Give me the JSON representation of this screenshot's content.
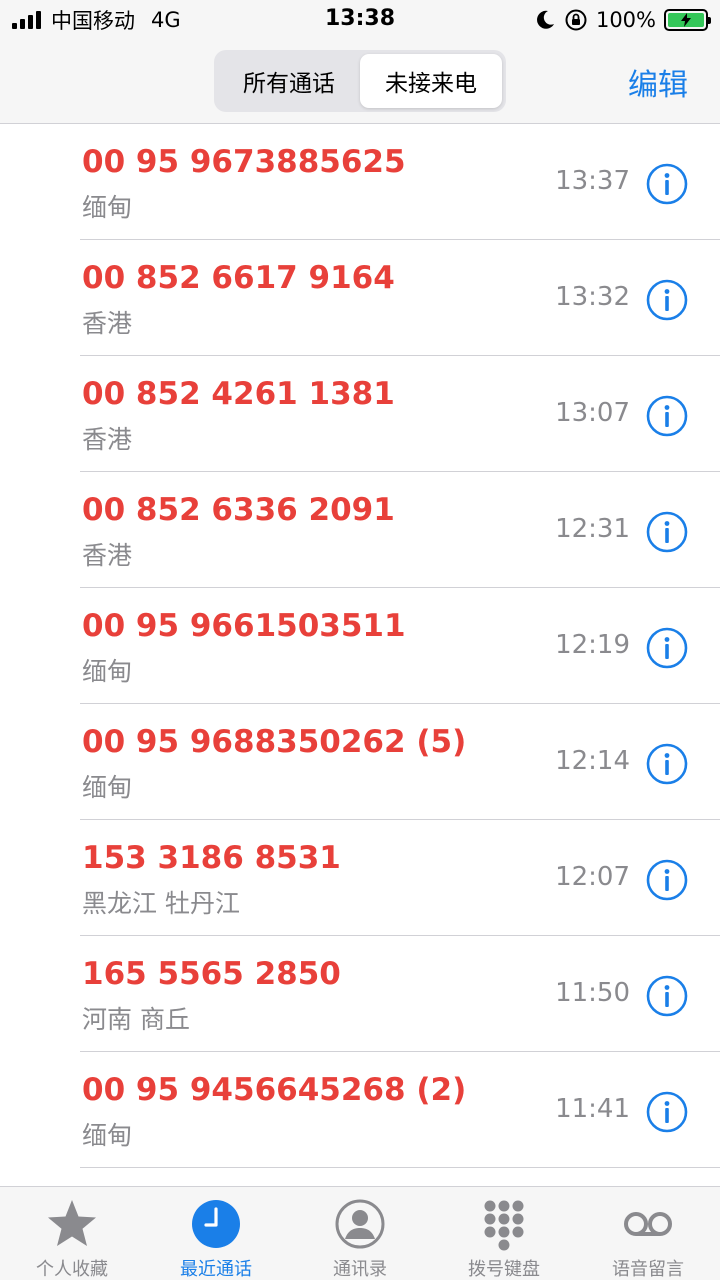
{
  "status_bar": {
    "carrier": "中国移动",
    "network": "4G",
    "time": "13:38",
    "battery": "100%",
    "battery_level": 100
  },
  "header": {
    "segments": [
      "所有通话",
      "未接来电"
    ],
    "active_segment": 1,
    "edit_label": "编辑"
  },
  "calls": [
    {
      "number": "00 95 9673885625",
      "location": "缅甸",
      "time": "13:37"
    },
    {
      "number": "00 852 6617 9164",
      "location": "香港",
      "time": "13:32"
    },
    {
      "number": "00 852 4261 1381",
      "location": "香港",
      "time": "13:07"
    },
    {
      "number": "00 852 6336 2091",
      "location": "香港",
      "time": "12:31"
    },
    {
      "number": "00 95 9661503511",
      "location": "缅甸",
      "time": "12:19"
    },
    {
      "number": "00 95 9688350262 (5)",
      "location": "缅甸",
      "time": "12:14"
    },
    {
      "number": "153 3186 8531",
      "location": "黑龙江 牡丹江",
      "time": "12:07"
    },
    {
      "number": "165 5565 2850",
      "location": "河南 商丘",
      "time": "11:50"
    },
    {
      "number": "00 95 9456645268 (2)",
      "location": "缅甸",
      "time": "11:41"
    }
  ],
  "tabs": [
    {
      "label": "个人收藏",
      "icon": "star-icon"
    },
    {
      "label": "最近通话",
      "icon": "clock-icon"
    },
    {
      "label": "通讯录",
      "icon": "contact-icon"
    },
    {
      "label": "拨号键盘",
      "icon": "keypad-icon"
    },
    {
      "label": "语音留言",
      "icon": "voicemail-icon"
    }
  ],
  "active_tab": 1,
  "colors": {
    "accent": "#1a7fe8",
    "missed": "#e8403a",
    "secondary_text": "#8a8a8e",
    "battery": "#34c759"
  }
}
